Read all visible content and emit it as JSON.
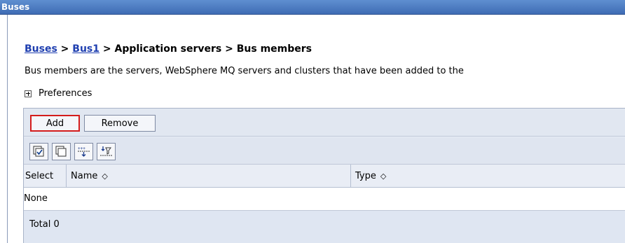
{
  "window": {
    "title": "Buses"
  },
  "breadcrumb": {
    "link1": "Buses",
    "sep1": " > ",
    "link2": "Bus1",
    "rest": " > Application servers > Bus members"
  },
  "description": "Bus members are the servers, WebSphere MQ servers and clusters that have been added to the",
  "preferences": {
    "label": "Preferences"
  },
  "buttons": {
    "add": "Add",
    "remove": "Remove"
  },
  "toolbar_icons": [
    "select-all-icon",
    "deselect-all-icon",
    "show-filter-icon",
    "clear-filter-icon"
  ],
  "table": {
    "columns": [
      "Select",
      "Name",
      "Type"
    ],
    "sort_glyph": "◇",
    "empty_text": "None",
    "total_label": "Total 0"
  },
  "colors": {
    "title_bar": "#4a78c0",
    "highlight_border": "#d41c1c",
    "link": "#1f3fb0"
  }
}
